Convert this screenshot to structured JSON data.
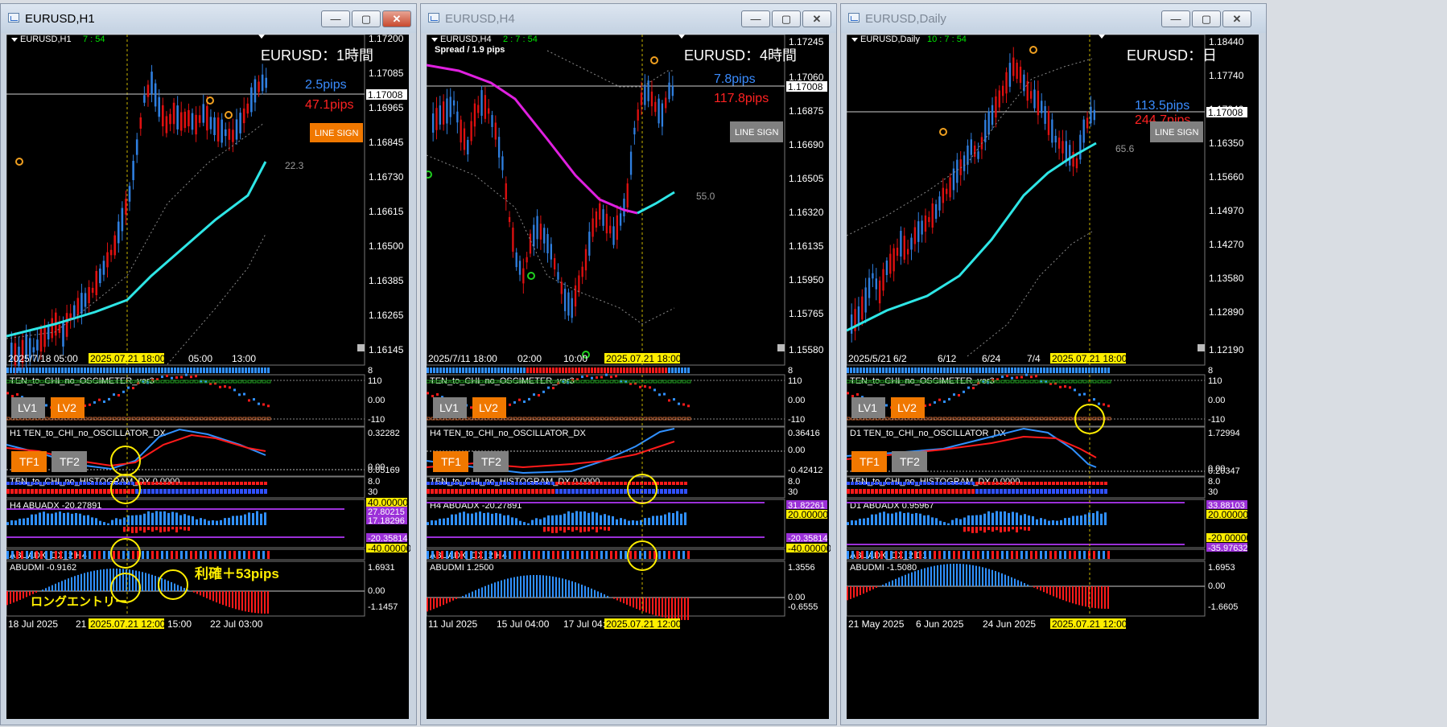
{
  "windows": [
    {
      "title": "EURUSD,H1",
      "symbol": "EURUSD,H1",
      "timer": "7 : 54",
      "heading": "EURUSD：1時間",
      "pips_blue": "2.5pips",
      "pips_red": "47.1pips",
      "line_sign": "LINE SIGN",
      "adx_value": "22.3",
      "current_price": "1.17008",
      "price_axis": [
        "1.17200",
        "1.17085",
        "1.16965",
        "1.16845",
        "1.16730",
        "1.16615",
        "1.16500",
        "1.16385",
        "1.16265",
        "1.16145"
      ],
      "time_axis": [
        "2025/7/18 05:00",
        "05:00",
        "13:00"
      ],
      "time_highlight": "2025.07.21 18:00",
      "osc_label": "TEN_to_CHI_no_OSCIMETER_ver3",
      "osc_axis": [
        "110",
        "0.00",
        "-110"
      ],
      "osc_axis_top": "8",
      "lv1": "LV1",
      "lv2": "LV2",
      "oscdx_label": "H1 TEN_to_CHI_no_OSCILLATOR_DX",
      "oscdx_axis": [
        "0.32282",
        "0.05169"
      ],
      "oscdx_axis_zero": "0.00",
      "tf1": "TF1",
      "tf2": "TF2",
      "hist_label": "TEN_to_CHI_no_HISTOGRAM_DX 0.0000",
      "hist_axis": [
        "8.0",
        "30"
      ],
      "abuadx_label": "H4 ABUADX -20.27891",
      "abuadx_axis": [
        "40.00000",
        "27.80215",
        "17.18296",
        "-20.35814",
        "-40.00000"
      ],
      "abuadx2_label": "ABUADX_DX_2 H4",
      "abudmi_label": "ABUDMI -0.9162",
      "abudmi_axis": [
        "1.6931",
        "0.00",
        "-1.1457"
      ],
      "bottom_axis": [
        "18 Jul 2025",
        "21",
        "15:00",
        "22 Jul 03:00"
      ],
      "bottom_highlight": "2025.07.21 12:00",
      "annot_entry": "ロングエントリー",
      "annot_profit": "利確＋53pips"
    },
    {
      "title": "EURUSD,H4",
      "symbol": "EURUSD,H4",
      "timer": "2 : 7 : 54",
      "spread": "Spread / 1.9 pips",
      "heading": "EURUSD：4時間",
      "pips_blue": "7.8pips",
      "pips_red": "117.8pips",
      "line_sign": "LINE SIGN",
      "adx_value": "55.0",
      "current_price": "1.17008",
      "price_axis": [
        "1.17245",
        "1.17060",
        "1.16875",
        "1.16690",
        "1.16505",
        "1.16320",
        "1.16135",
        "1.15950",
        "1.15765",
        "1.15580"
      ],
      "time_axis": [
        "2025/7/11 18:00",
        "02:00",
        "10:00"
      ],
      "time_highlight": "2025.07.21 18:00",
      "osc_label": "TEN_to_CHI_no_OSCIMETER_ver3",
      "osc_axis": [
        "110",
        "0.00",
        "-110"
      ],
      "osc_axis_top": "8",
      "lv1": "LV1",
      "lv2": "LV2",
      "oscdx_label": "H4 TEN_to_CHI_no_OSCILLATOR_DX",
      "oscdx_axis": [
        "0.36416",
        "-0.42412"
      ],
      "oscdx_axis_zero": "0.00",
      "tf1": "TF1",
      "tf2": "TF2",
      "hist_label": "TEN_to_CHI_no_HISTOGRAM_DX 0.0000",
      "hist_axis": [
        "8.0",
        "30"
      ],
      "abuadx_label": "H4 ABUADX -20.27891",
      "abuadx_axis": [
        "31.82261",
        "20.00000",
        "-20.35814",
        "-40.00000"
      ],
      "abuadx2_label": "ABUADX_DX_2 H4",
      "abudmi_label": "ABUDMI 1.2500",
      "abudmi_axis": [
        "1.3556",
        "0.00",
        "-0.6555"
      ],
      "bottom_axis": [
        "11 Jul 2025",
        "15 Jul 04:00",
        "17 Jul 04:00"
      ],
      "bottom_highlight": "2025.07.21 12:00"
    },
    {
      "title": "EURUSD,Daily",
      "symbol": "EURUSD,Daily",
      "timer": "10 : 7 : 54",
      "heading": "EURUSD：日",
      "pips_blue": "113.5pips",
      "pips_red": "244.7pips",
      "line_sign": "LINE SIGN",
      "adx_value": "65.6",
      "current_price": "1.17008",
      "price_axis": [
        "1.18440",
        "1.17740",
        "1.17040",
        "1.16350",
        "1.15660",
        "1.14970",
        "1.14270",
        "1.13580",
        "1.12890",
        "1.12190"
      ],
      "time_axis": [
        "2025/5/21",
        "6/2",
        "6/12",
        "6/24",
        "7/4"
      ],
      "time_highlight": "2025.07.21 18:00",
      "osc_label": "TEN_to_CHI_no_OSCIMETER_ver3",
      "osc_axis": [
        "110",
        "0.00",
        "-110"
      ],
      "osc_axis_top": "8",
      "lv1": "LV1",
      "lv2": "LV2",
      "oscdx_label": "D1 TEN_to_CHI_no_OSCILLATOR_DX",
      "oscdx_axis": [
        "1.72994",
        "0.20347"
      ],
      "oscdx_axis_zero": "0.00",
      "tf1": "TF1",
      "tf2": "TF2",
      "hist_label": "TEN_to_CHI_no_HISTOGRAM_DX 0.0000",
      "hist_axis": [
        "8.0",
        "30"
      ],
      "abuadx_label": "D1 ABUADX 0.95967",
      "abuadx_axis": [
        "33.88103",
        "20.00000",
        "-20.00000",
        "-35.97632"
      ],
      "abuadx2_label": "ABUADX_DX_2 D1",
      "abudmi_label": "ABUDMI -1.5080",
      "abudmi_axis": [
        "1.6953",
        "0.00",
        "-1.6605"
      ],
      "bottom_axis": [
        "21 May 2025",
        "6 Jun 2025",
        "24 Jun 2025"
      ],
      "bottom_highlight": "2025.07.21 12:00"
    }
  ],
  "title_buttons": {
    "minimize": "—",
    "maximize": "▢",
    "close": "✕"
  },
  "colors": {
    "bull": "#2f7fe0",
    "bear": "#e01010",
    "ma_cyan": "#2ee6e6",
    "ma_magenta": "#e020e0",
    "sign_active": "#f07800",
    "sign_inactive": "#808080",
    "highlight": "#ffee00",
    "osc_red": "#ff1a1a",
    "osc_blue": "#3090ff",
    "adx_purple": "#9b30d8"
  }
}
